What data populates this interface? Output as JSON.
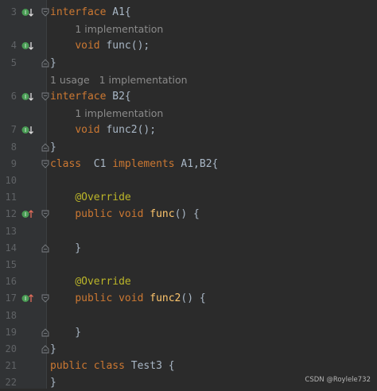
{
  "editor": {
    "rows": [
      {
        "line": "3",
        "marker": "down",
        "fold": "start",
        "code": [
          {
            "t": "interface",
            "c": "kw"
          },
          {
            "t": " A1{",
            "c": ""
          }
        ]
      },
      {
        "hint": "1 implementation",
        "indent": "4"
      },
      {
        "line": "4",
        "marker": "down",
        "code": [
          {
            "t": "    "
          },
          {
            "t": "void",
            "c": "kw"
          },
          {
            "t": " "
          },
          {
            "t": "func",
            "c": "fi"
          },
          {
            "t": "();"
          }
        ]
      },
      {
        "line": "5",
        "fold": "end",
        "code": [
          {
            "t": "}"
          }
        ]
      },
      {
        "hint": "1 usage   1 implementation",
        "indent": "0"
      },
      {
        "line": "6",
        "marker": "down",
        "fold": "start",
        "code": [
          {
            "t": "interface",
            "c": "kw"
          },
          {
            "t": " B2{"
          }
        ]
      },
      {
        "hint": "1 implementation",
        "indent": "4"
      },
      {
        "line": "7",
        "marker": "down",
        "code": [
          {
            "t": "    "
          },
          {
            "t": "void",
            "c": "kw"
          },
          {
            "t": " "
          },
          {
            "t": "func2",
            "c": "fi"
          },
          {
            "t": "();"
          }
        ]
      },
      {
        "line": "8",
        "fold": "end",
        "code": [
          {
            "t": "}"
          }
        ]
      },
      {
        "line": "9",
        "fold": "start",
        "code": [
          {
            "t": "class",
            "c": "kw"
          },
          {
            "t": "  C1 "
          },
          {
            "t": "implements",
            "c": "kw"
          },
          {
            "t": " A1,B2{"
          }
        ]
      },
      {
        "line": "10",
        "code": []
      },
      {
        "line": "11",
        "code": [
          {
            "t": "    "
          },
          {
            "t": "@Override",
            "c": "ann"
          }
        ]
      },
      {
        "line": "12",
        "marker": "up",
        "fold": "start",
        "code": [
          {
            "t": "    "
          },
          {
            "t": "public",
            "c": "kw"
          },
          {
            "t": " "
          },
          {
            "t": "void",
            "c": "kw"
          },
          {
            "t": " "
          },
          {
            "t": "func",
            "c": "fn"
          },
          {
            "t": "() {"
          }
        ]
      },
      {
        "line": "13",
        "code": []
      },
      {
        "line": "14",
        "fold": "end",
        "code": [
          {
            "t": "    }"
          }
        ]
      },
      {
        "line": "15",
        "code": []
      },
      {
        "line": "16",
        "code": [
          {
            "t": "    "
          },
          {
            "t": "@Override",
            "c": "ann"
          }
        ]
      },
      {
        "line": "17",
        "marker": "up",
        "fold": "start",
        "code": [
          {
            "t": "    "
          },
          {
            "t": "public",
            "c": "kw"
          },
          {
            "t": " "
          },
          {
            "t": "void",
            "c": "kw"
          },
          {
            "t": " "
          },
          {
            "t": "func2",
            "c": "fn"
          },
          {
            "t": "() {"
          }
        ]
      },
      {
        "line": "18",
        "code": []
      },
      {
        "line": "19",
        "fold": "end",
        "code": [
          {
            "t": "    }"
          }
        ]
      },
      {
        "line": "20",
        "fold": "end",
        "code": [
          {
            "t": "}"
          }
        ]
      },
      {
        "line": "21",
        "code": [
          {
            "t": "public",
            "c": "kw"
          },
          {
            "t": " "
          },
          {
            "t": "class",
            "c": "kw"
          },
          {
            "t": " Test3 {"
          }
        ]
      },
      {
        "line": "22",
        "code": [
          {
            "t": "}"
          }
        ]
      }
    ]
  },
  "watermark": "CSDN @Roylele732",
  "colors": {
    "keyword": "#cc7832",
    "function": "#ffc66d",
    "annotation": "#bbb529",
    "marker": "#499c54"
  }
}
